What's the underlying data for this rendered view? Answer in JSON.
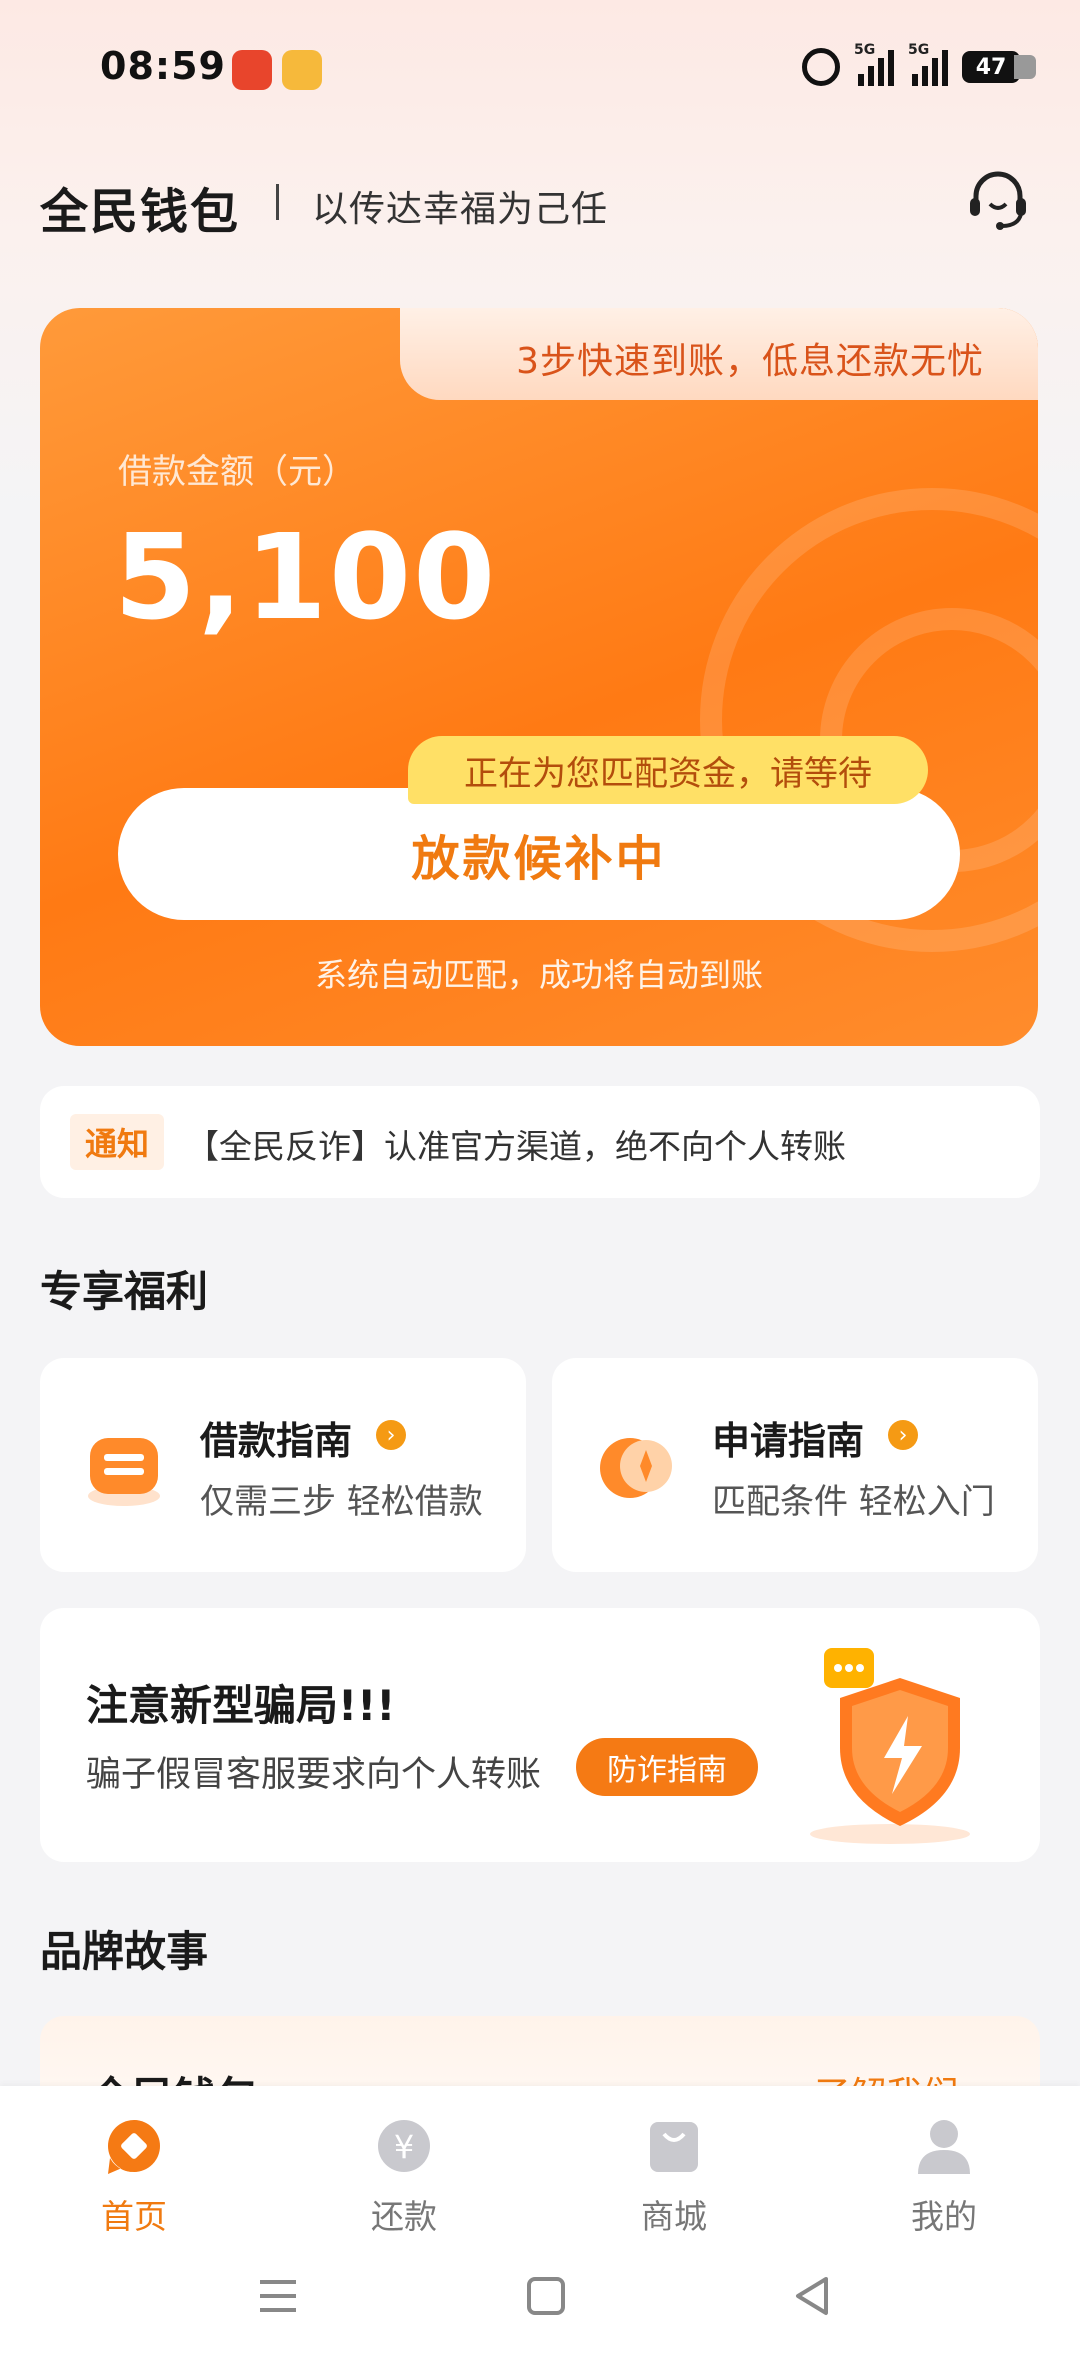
{
  "status_bar": {
    "time": "08:59",
    "battery": "47",
    "network1": "5G",
    "network2": "5G"
  },
  "header": {
    "brand": "全民钱包",
    "slogan": "以传达幸福为己任"
  },
  "loan_card": {
    "tab_text": "3步快速到账，低息还款无忧",
    "amount_label": "借款金额（元）",
    "amount": "5,100",
    "tip": "正在为您匹配资金，请等待",
    "button": "放款候补中",
    "footer": "系统自动匹配，成功将自动到账"
  },
  "notice": {
    "tag": "通知",
    "text": "【全民反诈】认准官方渠道，绝不向个人转账"
  },
  "benefits": {
    "title": "专享福利",
    "items": [
      {
        "title": "借款指南",
        "subtitle": "仅需三步 轻松借款"
      },
      {
        "title": "申请指南",
        "subtitle": "匹配条件 轻松入门"
      }
    ]
  },
  "fraud": {
    "title": "注意新型骗局!!!",
    "subtitle": "骗子假冒客服要求向个人转账",
    "button": "防诈指南"
  },
  "brand_story": {
    "title": "品牌故事",
    "card_title": "全民钱包",
    "link": "了解我们 >"
  },
  "nav": {
    "items": [
      {
        "label": "首页",
        "icon": "home-icon",
        "active": true
      },
      {
        "label": "还款",
        "icon": "yuan-icon",
        "active": false
      },
      {
        "label": "商城",
        "icon": "shopping-bag-icon",
        "active": false
      },
      {
        "label": "我的",
        "icon": "profile-icon",
        "active": false
      }
    ]
  },
  "colors": {
    "accent": "#f07a10",
    "card_orange": "#ff7a14",
    "tip_yellow": "#ffe066"
  }
}
